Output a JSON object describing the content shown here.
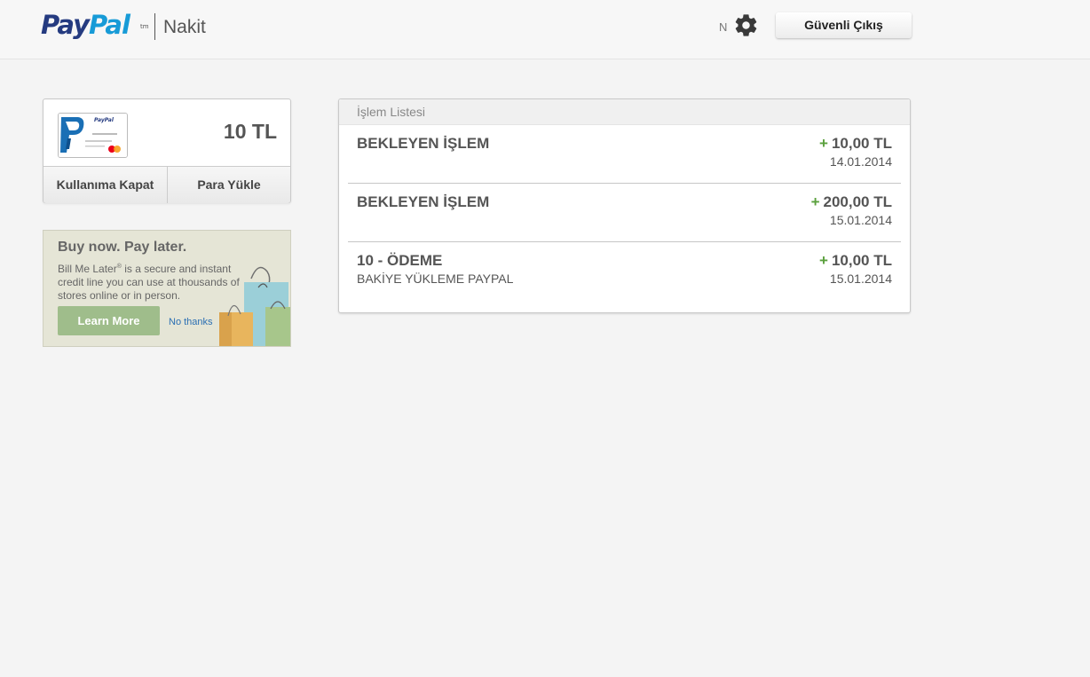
{
  "header": {
    "brand_pay": "Pay",
    "brand_pal": "Pal",
    "brand_tm": "tm",
    "product": "Nakit",
    "user_initial": "N",
    "logout_label": "Güvenli Çıkış"
  },
  "wallet": {
    "balance": "10 TL",
    "actions": [
      "Kullanıma Kapat",
      "Para Yükle"
    ]
  },
  "promo": {
    "title": "Buy now. Pay later.",
    "brand_name": "Bill Me Later",
    "reg_mark": "®",
    "text": " is a secure and instant credit line you can use at thousands of stores online or in person.",
    "learn_more": "Learn More",
    "no_thanks": "No thanks"
  },
  "transactions": {
    "title": "İşlem Listesi",
    "items": [
      {
        "name": "BEKLEYEN İŞLEM",
        "sub": "",
        "sign": "+",
        "amount": "10,00 TL",
        "date": "14.01.2014"
      },
      {
        "name": "BEKLEYEN İŞLEM",
        "sub": "",
        "sign": "+",
        "amount": "200,00 TL",
        "date": "15.01.2014"
      },
      {
        "name": "10 - ÖDEME",
        "sub": "BAKİYE YÜKLEME PAYPAL",
        "sign": "+",
        "amount": "10,00 TL",
        "date": "15.01.2014"
      }
    ]
  },
  "colors": {
    "brand_dark": "#253b80",
    "brand_light": "#179bd7",
    "positive": "#5aa03c",
    "promo_button": "#9fbd8b"
  },
  "icons": {
    "settings": "gear-icon",
    "card": "paypal-card-icon",
    "bags": "shopping-bags-icon"
  }
}
